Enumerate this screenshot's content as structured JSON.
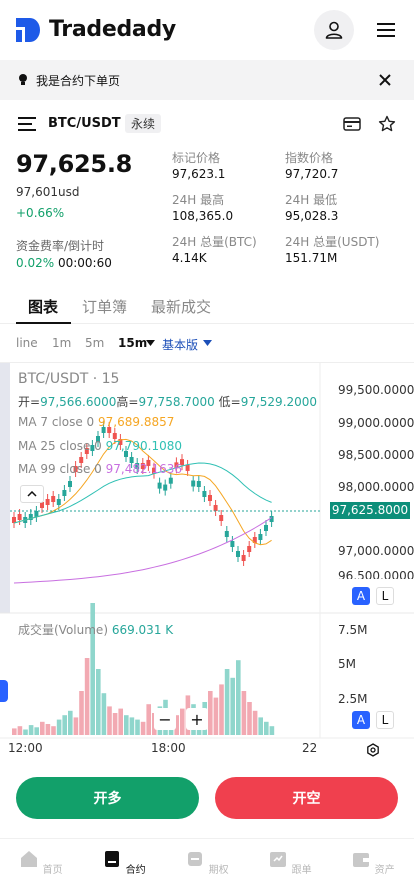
{
  "app": {
    "name": "Tradedady"
  },
  "notice": {
    "text": "我是合约下单页"
  },
  "ticker": {
    "pair": "BTC/USDT",
    "tag": "永续",
    "last_price": "97,625.8",
    "last_price_usd": "97,601usd",
    "change": "+0.66%",
    "funding_label": "资金费率/倒计时",
    "funding_rate": "0.02%",
    "countdown": "00:00:60",
    "stats": [
      {
        "label": "标记价格",
        "value": "97,623.1"
      },
      {
        "label": "指数价格",
        "value": "97,720.7"
      },
      {
        "label": "24H 最高",
        "value": "108,365.0"
      },
      {
        "label": "24H 最低",
        "value": "95,028.3"
      },
      {
        "label": "24H 总量(BTC)",
        "value": "4.14K"
      },
      {
        "label": "24H 总量(USDT)",
        "value": "151.71M"
      }
    ]
  },
  "tabs": [
    "图表",
    "订单簿",
    "最新成交"
  ],
  "intervals": {
    "items": [
      "line",
      "1m",
      "5m",
      "15m"
    ],
    "selected": "15m",
    "mode": "基本版"
  },
  "chart": {
    "title": "BTC/USDT · 15",
    "ohlc": {
      "open_label": "开=",
      "open": "97,566.6000",
      "high_label": "高=",
      "high": "97,758.7000",
      "low_label": "低=",
      "low": "97,529.2000"
    },
    "ma7_label": "MA 7 close 0",
    "ma7_value": "97,689.8857",
    "ma25_label": "MA 25 close 0",
    "ma25_value": "97,790.1080",
    "ma99_label": "MA 99 close 0",
    "ma99_value": "97,482.1636",
    "price_axis": [
      "99,500.0000",
      "99,000.0000",
      "98,500.0000",
      "98,000.0000",
      "97,000.0000",
      "96,500.0000"
    ],
    "current_price_tag": "97,625.8000",
    "volume_label": "成交量(Volume)",
    "volume_value": "669.031 K",
    "volume_axis": [
      "7.5M",
      "5M",
      "2.5M"
    ],
    "time_axis": [
      "12:00",
      "18:00",
      "22"
    ],
    "scale_a": "A",
    "scale_l": "L",
    "zoom_out": "−",
    "zoom_in": "+",
    "colors": {
      "up": "#26a69a",
      "down": "#ef5350",
      "ma7": "#f5a623",
      "ma25": "#30c0b4",
      "ma99": "#c86fe0"
    }
  },
  "actions": {
    "long": "开多",
    "short": "开空"
  },
  "bottom_nav": [
    {
      "label": "首页",
      "icon": "home-icon"
    },
    {
      "label": "合约",
      "icon": "contract-icon"
    },
    {
      "label": "期权",
      "icon": "options-icon"
    },
    {
      "label": "跟单",
      "icon": "copy-trade-icon"
    },
    {
      "label": "资产",
      "icon": "wallet-icon"
    }
  ]
}
